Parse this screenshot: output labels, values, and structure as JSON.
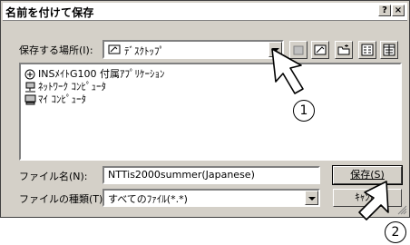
{
  "dialog": {
    "title": "名前を付けて保存",
    "help_button": "?",
    "close_button": "×"
  },
  "save_in": {
    "label": "保存する場所(I):",
    "value": "ﾃﾞｽｸﾄｯﾌﾟ"
  },
  "file_list": {
    "items": [
      {
        "label": "INSﾒｲﾄG100 付属ｱﾌﾟﾘｹｰｼｮﾝ",
        "icon": "folder-icon"
      },
      {
        "label": "ﾈｯﾄﾜｰｸ ｺﾝﾋﾟｭｰﾀ",
        "icon": "network-computer-icon"
      },
      {
        "label": "ﾏｲ ｺﾝﾋﾟｭｰﾀ",
        "icon": "my-computer-icon"
      }
    ]
  },
  "filename": {
    "label": "ファイル名(N):",
    "value": "NTTis2000summer(Japanese)"
  },
  "filetype": {
    "label": "ファイルの種類(T):",
    "value": "すべてのﾌｧｲﾙ(*.*)"
  },
  "buttons": {
    "save": "保存(S)",
    "cancel": "ｷｬﾝｾﾙ"
  },
  "annotations": {
    "step1": "1",
    "step2": "2"
  }
}
